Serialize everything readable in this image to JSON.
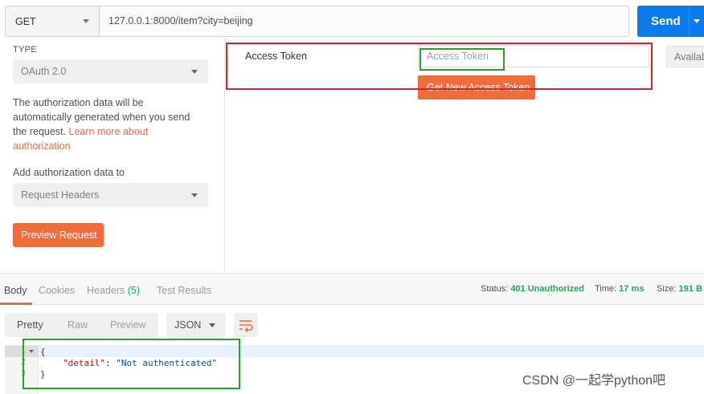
{
  "request": {
    "method": "GET",
    "url": "127.0.0.1:8000/item?city=beijing",
    "send_label": "Send"
  },
  "auth": {
    "type_label": "TYPE",
    "type_value": "OAuth 2.0",
    "description": "The authorization data will be automatically generated when you send the request. ",
    "link_text": "Learn more about authorization",
    "add_to_label": "Add authorization data to",
    "add_to_value": "Request Headers",
    "preview_label": "Preview Request"
  },
  "token": {
    "label": "Access Token",
    "placeholder": "Access Token",
    "available_label": "Availab",
    "get_new_label": "Get New Access Token"
  },
  "response": {
    "tabs": [
      {
        "label": "Body"
      },
      {
        "label": "Cookies"
      },
      {
        "label": "Headers",
        "count": "(5)"
      },
      {
        "label": "Test Results"
      }
    ],
    "status_label": "Status:",
    "status_value": "401 Unauthorized",
    "time_label": "Time:",
    "time_value": "17 ms",
    "size_label": "Size:",
    "size_value": "191 B"
  },
  "format": {
    "views": [
      "Pretty",
      "Raw",
      "Preview"
    ],
    "type": "JSON"
  },
  "body": {
    "line_numbers": [
      "1",
      "2",
      "3"
    ],
    "open_brace": "{",
    "key": "\"detail\"",
    "colon": ": ",
    "value": "\"Not authenticated\"",
    "close_brace": "}"
  },
  "watermark": "CSDN @一起学python吧",
  "colors": {
    "accent_orange": "#f26b3a",
    "send_blue": "#097bed",
    "status_green": "#26a65b",
    "annotation_red": "#e02020",
    "annotation_green": "#23a623"
  }
}
